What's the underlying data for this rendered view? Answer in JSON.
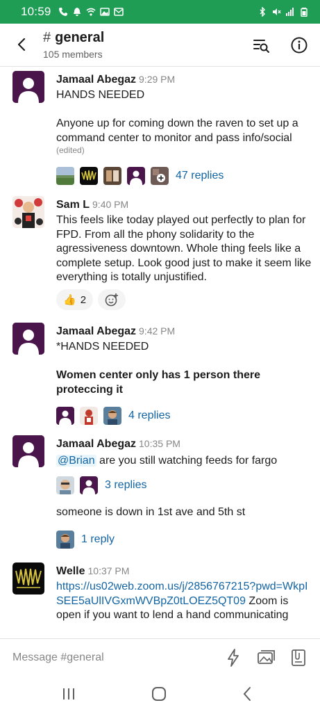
{
  "status_bar": {
    "time": "10:59"
  },
  "header": {
    "channel_hash": "#",
    "channel_name": "general",
    "member_count": "105 members"
  },
  "messages": [
    {
      "author": "Jamaal Abegaz",
      "time": "9:29 PM",
      "line1": "HANDS NEEDED",
      "line2": "Anyone up for coming down the raven to set up a command center to monitor and pass info/social",
      "edited": "(edited)",
      "replies": "47 replies"
    },
    {
      "author": "Sam L",
      "time": "9:40 PM",
      "text": "This feels like today played out perfectly to plan for FPD. From all the phony solidarity to the agressiveness downtown. Whole thing feels like a complete setup. Look good just to make it seem like everything is totally unjustified.",
      "reaction_emoji": "👍",
      "reaction_count": "2"
    },
    {
      "author": "Jamaal Abegaz",
      "time": "9:42 PM",
      "line1": "*HANDS NEEDED",
      "line2": "Women center only has 1 person there proteccing it",
      "replies": "4 replies"
    },
    {
      "author": "Jamaal Abegaz",
      "time": "10:35 PM",
      "mention": "@Brian",
      "text_after_mention": " are you still watching feeds for fargo",
      "replies": "3 replies",
      "followup": "someone is down in 1st ave and 5th st",
      "followup_replies": "1 reply"
    },
    {
      "author": "Welle",
      "time": "10:37 PM",
      "link": "https://us02web.zoom.us/j/2856767215?pwd=WkpISEE5aUlIVGxmWVBpZ0tLOEZ5QT09",
      "text_after_link": " Zoom is open if you want to lend a hand communicating"
    }
  ],
  "composer": {
    "placeholder": "Message #general"
  },
  "colors": {
    "status_bar": "#1f9d55",
    "link": "#1264a3",
    "avatar_default": "#4a154b"
  },
  "icons": {
    "header": [
      "back-arrow-icon",
      "search-messages-icon",
      "info-icon"
    ],
    "composer": [
      "shortcuts-lightning-icon",
      "image-gallery-icon",
      "file-attach-icon"
    ],
    "navigation": [
      "recents-icon",
      "home-icon",
      "back-icon"
    ]
  }
}
